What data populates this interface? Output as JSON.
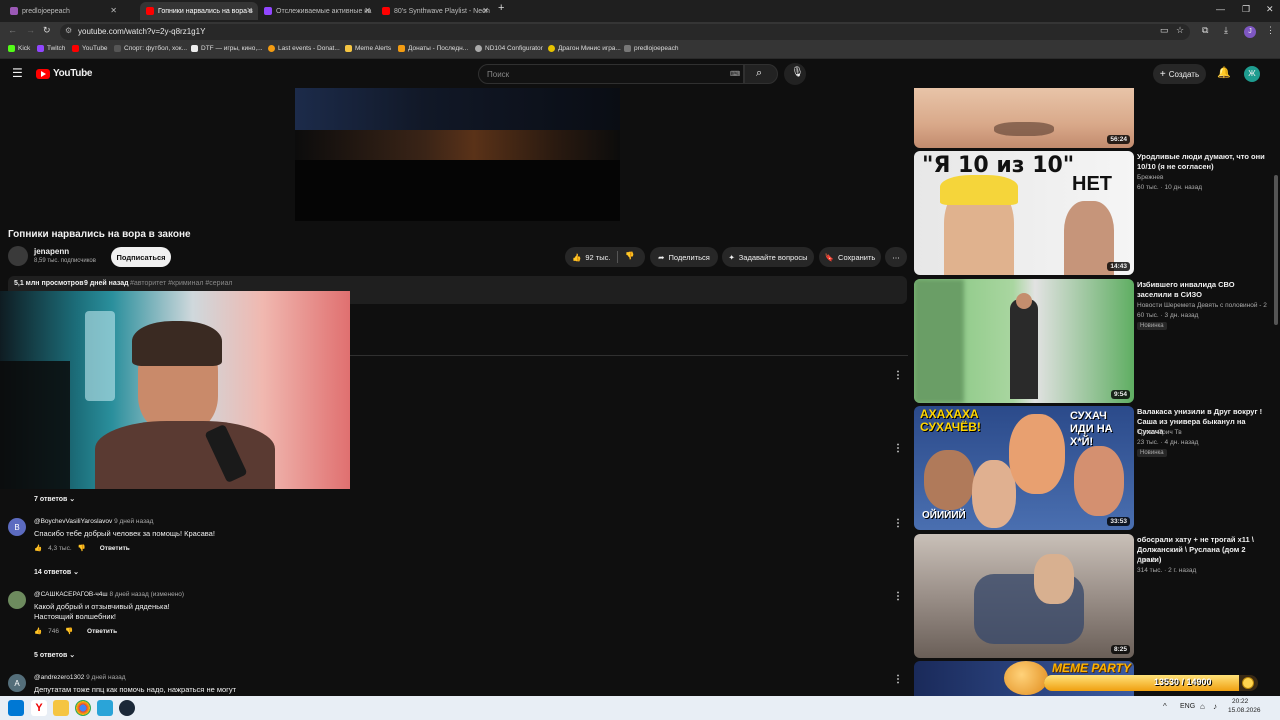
{
  "browser": {
    "tabs": [
      {
        "title": "predlojoepeach",
        "color": "#9b59b6"
      },
      {
        "title": "Гопники нарвались на вора в",
        "color": "#ff0000"
      },
      {
        "title": "Отслеживаемые активные ка",
        "color": "#9146ff"
      },
      {
        "title": "80's Synthwave Playlist - Neon",
        "color": "#ff0000"
      }
    ],
    "url": "youtube.com/watch?v=2y-q8rz1g1Y",
    "profile_letter": "J",
    "bookmarks": [
      "Kick",
      "Twitch",
      "YouTube",
      "Спорт: футбол, хок...",
      "DTF — игры, кино,...",
      "Last events - Donat...",
      "Meme Alerts",
      "Донаты - Последн...",
      "ND104 Configurator",
      "Драгон Минис игра...",
      "predlojoepeach"
    ]
  },
  "youtube": {
    "logo": "YouTube",
    "search_placeholder": "Поиск",
    "create_label": "Создать",
    "avatar_letter": "Ж"
  },
  "video": {
    "title": "Гопники нарвались на вора в законе",
    "channel": "jenapenn",
    "subscribers": "8,59 тыс. подписчиков",
    "subscribe_label": "Подписаться",
    "likes": "92 тыс.",
    "share_label": "Поделиться",
    "ask_label": "Задавайте вопросы",
    "save_label": "Сохранить",
    "views": "5,1 млн просмотров",
    "age": "9 дней назад",
    "tags": "#авторитет #криминал #сериал"
  },
  "comments": {
    "replies_first": "7 ответов",
    "items": [
      {
        "avatar": "B",
        "color": "#5c6bc0",
        "author": "@BoychevVasiliYaroslavov",
        "time": "9 дней назад",
        "lines": [
          "Спасибо тебе добрый человек за помощь! Красава!"
        ],
        "likes": "4,3 тыс.",
        "reply_label": "Ответить",
        "replies": "14 ответов"
      },
      {
        "avatar": "",
        "color": "#6d8b5e",
        "author": "@САШКАСЕРАГОВ-ч4ш",
        "time": "8 дней назад (изменено)",
        "lines": [
          "Какой добрый и отзывчивый дяденька!",
          "Настоящий волшебник!"
        ],
        "likes": "746",
        "reply_label": "Ответить",
        "replies": "5 ответов"
      },
      {
        "avatar": "A",
        "color": "#546e7a",
        "author": "@andrezero1302",
        "time": "9 дней назад",
        "lines": [
          "Депутатам тоже ппц как помочь надо, нажраться не могут"
        ],
        "likes": "",
        "reply_label": "",
        "replies": ""
      }
    ]
  },
  "sidebar": [
    {
      "duration": "56:24",
      "title": "",
      "channel": "",
      "meta": "",
      "badge": ""
    },
    {
      "duration": "14:43",
      "title": "Уродливые люди думают, что они 10/10 (я не согласен)",
      "channel": "Брежнев",
      "meta": "60 тыс. · 10 дн. назад",
      "badge": "",
      "overlay_text": "\"Я 10 из 10\"",
      "overlay_text2": "НЕТ"
    },
    {
      "duration": "9:54",
      "title": "Избившего инвалида СВО заселили в СИЗО",
      "channel": "Новости Шеремета Девять с половиной - 2",
      "meta": "60 тыс. · 3 дн. назад",
      "badge": "Новинка"
    },
    {
      "duration": "33:53",
      "title": "Валакаса унизили в Друг вокруг ! Саша из универа быканул на Сухача",
      "channel": "Трич и Трич Тв",
      "meta": "23 тыс. · 4 дн. назад",
      "badge": "Новинка",
      "overlay_text": "АХАХАХА СУХАЧЁВ!",
      "overlay_text2": "СУХАЧ ИДИ НА Х*Й!",
      "overlay_text3": "ОЙИЙИЙ"
    },
    {
      "duration": "8:25",
      "title": "обосрали хату + не трогай х11 \\ Должанский \\ Руслана (дом 2 драки)",
      "channel": "Дом 2",
      "meta": "314 тыс. · 2 г. назад",
      "badge": ""
    }
  ],
  "overlay_widget": {
    "label": "MEME PARTY",
    "progress_text": "13530 / 14900"
  },
  "taskbar": {
    "lang": "ENG",
    "time": "20:22",
    "date": "15.08.2026"
  }
}
